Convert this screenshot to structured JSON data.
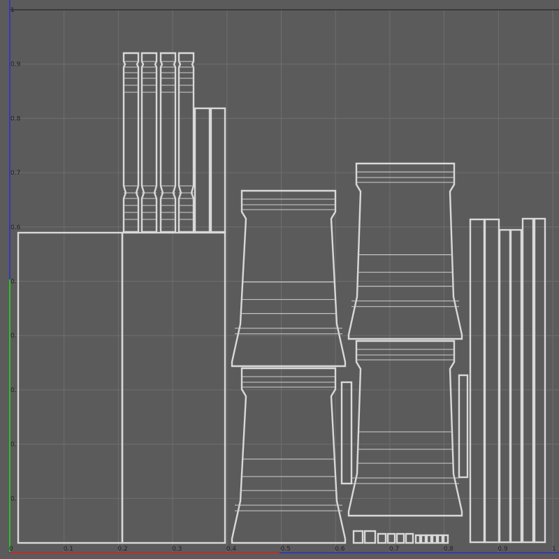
{
  "viewport": {
    "u_labels": [
      "0",
      "0.1",
      "0.2",
      "0.3",
      "0.4",
      "0.5",
      "0.6",
      "0.7",
      "0.8",
      "0.9",
      "1"
    ],
    "v_labels": [
      "0",
      "0.",
      "0.",
      "0.",
      "0.",
      "0.",
      "0.6",
      "0.7",
      "0.8",
      "0.9",
      "1"
    ],
    "colors": {
      "background": "#5b5b5b",
      "grid": "#6e6e6e",
      "uv_wire": "#d9d9d9",
      "u_axis": "#c42a2a",
      "v_axis": "#2d2dd0",
      "v_axis_selected": "#2fbf2f"
    }
  }
}
